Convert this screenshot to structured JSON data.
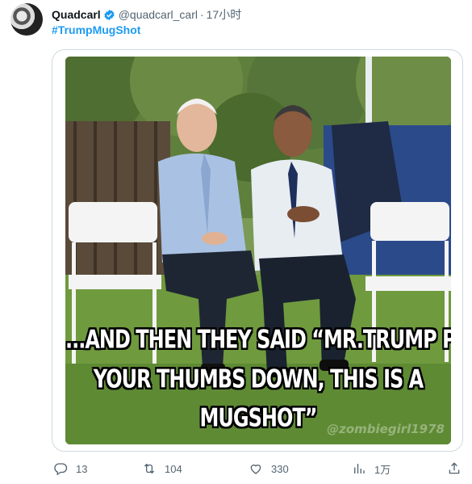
{
  "tweet": {
    "author_name": "Quadcarl",
    "handle": "@quadcarl_carl",
    "separator": "·",
    "time": "17小时",
    "hashtag": "#TrumpMugShot"
  },
  "meme": {
    "caption_line1": "...AND THEN THEY SAID “MR.TRUMP PUT",
    "caption_line2": "YOUR THUMBS DOWN, THIS IS A",
    "caption_line3": "MUGSHOT”",
    "watermark": "@zombiegirl1978"
  },
  "actions": {
    "reply_count": "13",
    "retweet_count": "104",
    "like_count": "330",
    "views_count": "1万"
  },
  "icons": {
    "verified": "verified-badge-icon",
    "reply": "reply-icon",
    "retweet": "retweet-icon",
    "like": "like-icon",
    "views": "views-icon",
    "share": "share-icon"
  },
  "colors": {
    "accent": "#1d9bf0",
    "secondary_text": "#536471",
    "border": "#cfd9de"
  }
}
